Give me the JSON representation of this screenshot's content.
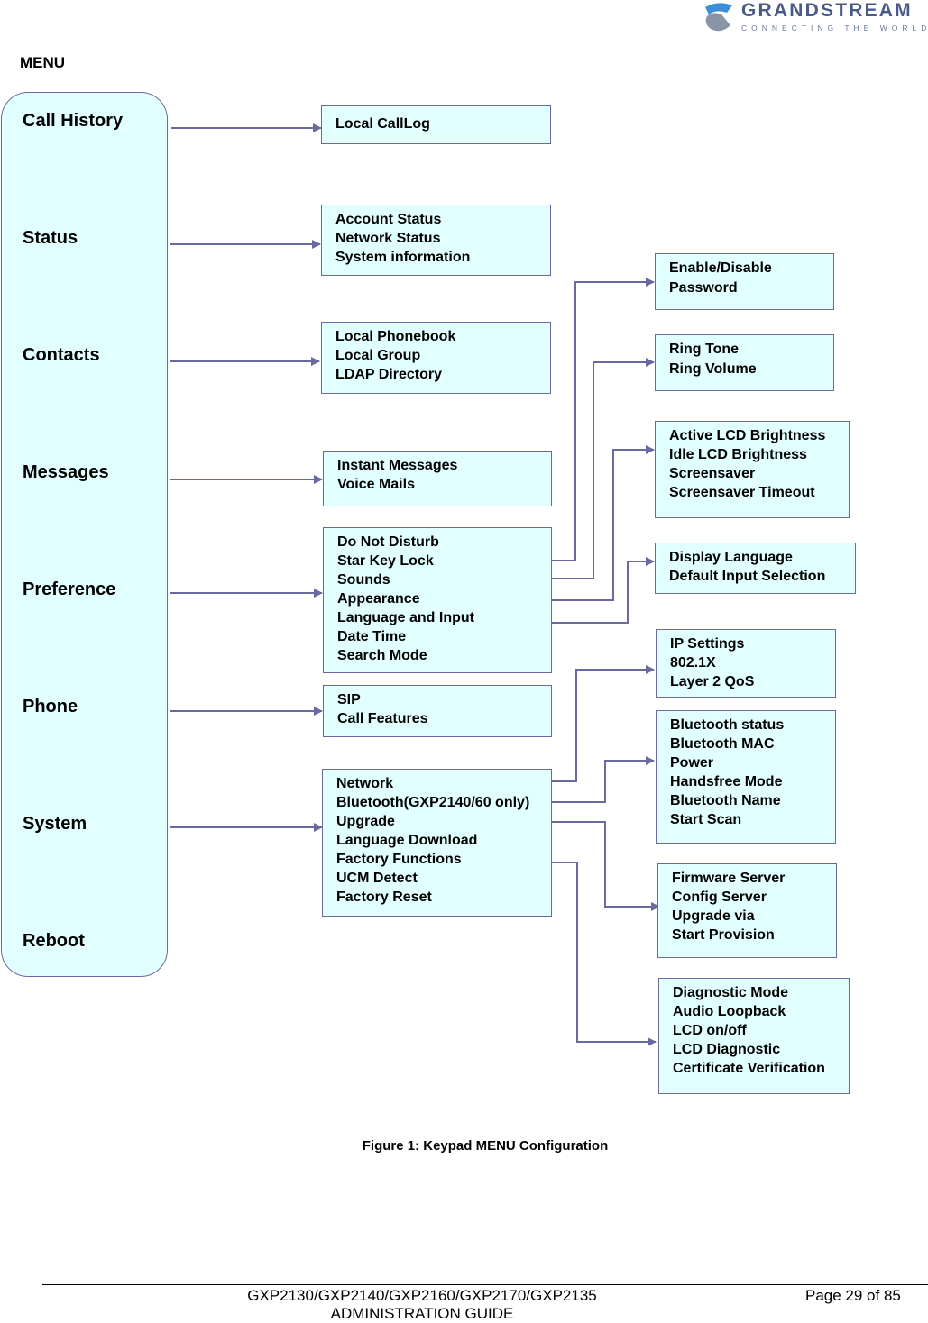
{
  "logo": {
    "name": "GRANDSTREAM",
    "tagline": "CONNECTING THE WORLD",
    "colors": {
      "primary": "#4a5a86",
      "accent": "#3a8fd8"
    }
  },
  "heading": "MENU",
  "menu_items": [
    "Call History",
    "Status",
    "Contacts",
    "Messages",
    "Preference",
    "Phone",
    "System",
    "Reboot"
  ],
  "level1": {
    "call_history": [
      "Local CallLog"
    ],
    "status": [
      "Account Status",
      "Network Status",
      "System information"
    ],
    "contacts": [
      "Local Phonebook",
      "Local Group",
      "LDAP Directory"
    ],
    "messages": [
      "Instant Messages",
      "Voice Mails"
    ],
    "preference": [
      "Do Not Disturb",
      "Star Key Lock",
      "Sounds",
      "Appearance",
      "Language and Input",
      "Date Time",
      "Search Mode"
    ],
    "phone": [
      "SIP",
      "Call Features"
    ],
    "system": [
      "Network",
      "Bluetooth(GXP2140/60 only)",
      "Upgrade",
      "Language Download",
      "Factory Functions",
      "UCM Detect",
      "Factory Reset"
    ]
  },
  "level2": {
    "star_key_lock": [
      "Enable/Disable",
      "Password"
    ],
    "sounds": [
      "Ring Tone",
      "Ring Volume"
    ],
    "appearance": [
      "Active LCD Brightness",
      "Idle LCD Brightness",
      "Screensaver",
      "Screensaver Timeout"
    ],
    "language_input": [
      "Display Language",
      "Default Input Selection"
    ],
    "network": [
      "IP Settings",
      "802.1X",
      "Layer 2 QoS"
    ],
    "bluetooth": [
      "Bluetooth status",
      "Bluetooth MAC",
      "Power",
      "Handsfree Mode",
      "Bluetooth Name",
      "Start Scan"
    ],
    "upgrade": [
      "Firmware Server",
      "Config Server",
      "Upgrade via",
      "Start Provision"
    ],
    "factory_functions": [
      "Diagnostic Mode",
      "Audio Loopback",
      "LCD on/off",
      "LCD Diagnostic",
      "Certificate Verification"
    ]
  },
  "colors": {
    "box_fill": "#e2ffff",
    "line": "#6a6aa0"
  },
  "caption": "Figure 1: Keypad MENU Configuration",
  "footer": {
    "doc_title_line1": "GXP2130/GXP2140/GXP2160/GXP2170/GXP2135",
    "doc_title_line2": "ADMINISTRATION GUIDE",
    "page": "Page 29 of 85"
  }
}
